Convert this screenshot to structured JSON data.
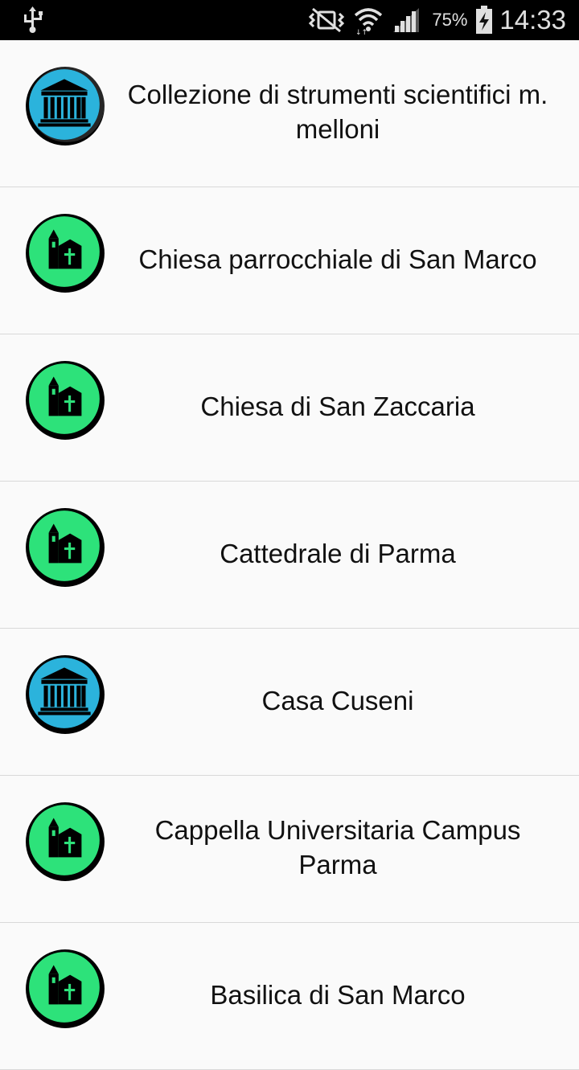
{
  "status_bar": {
    "icons": [
      "usb-icon",
      "vibrate-mute-icon",
      "wifi-icon",
      "signal-icon",
      "battery-charging-icon"
    ],
    "battery_percent": "75%",
    "time": "14:33"
  },
  "places": [
    {
      "name": "Collezione di strumenti scientifici m. melloni",
      "category": "museum",
      "icon": "museum-icon",
      "color": "#2bb3dc"
    },
    {
      "name": "Chiesa parrocchiale di San Marco",
      "category": "church",
      "icon": "church-icon",
      "color": "#2de27a"
    },
    {
      "name": "Chiesa di San Zaccaria",
      "category": "church",
      "icon": "church-icon",
      "color": "#2de27a"
    },
    {
      "name": "Cattedrale di Parma",
      "category": "church",
      "icon": "church-icon",
      "color": "#2de27a"
    },
    {
      "name": "Casa Cuseni",
      "category": "museum",
      "icon": "museum-icon",
      "color": "#2bb3dc"
    },
    {
      "name": "Cappella Universitaria Campus Parma",
      "category": "church",
      "icon": "church-icon",
      "color": "#2de27a"
    },
    {
      "name": "Basilica di San Marco",
      "category": "church",
      "icon": "church-icon",
      "color": "#2de27a"
    }
  ]
}
